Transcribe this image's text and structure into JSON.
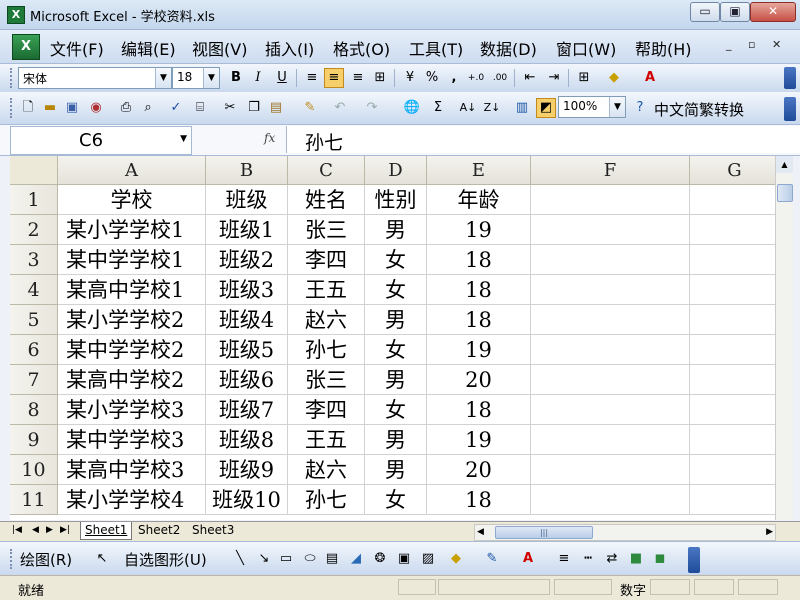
{
  "window": {
    "title": "Microsoft Excel - 学校资料.xls",
    "controls": {
      "minimize": "▭",
      "restore": "▣",
      "close": "✕"
    }
  },
  "menubar": {
    "items": [
      "文件(F)",
      "编辑(E)",
      "视图(V)",
      "插入(I)",
      "格式(O)",
      "工具(T)",
      "数据(D)",
      "窗口(W)",
      "帮助(H)"
    ],
    "doc_controls": {
      "minimize": "_",
      "restore": "▫",
      "close": "✕"
    }
  },
  "format_toolbar": {
    "font": "宋体",
    "size": "18",
    "bold": "B",
    "italic": "I",
    "underline": "U",
    "percent": "%",
    "comma": ","
  },
  "standard_toolbar": {
    "zoom": "100%",
    "chinese_convert": "中文简繁转换"
  },
  "formula_bar": {
    "name_box": "C6",
    "fx": "fx",
    "value": "孙七"
  },
  "sheet": {
    "columns": [
      "A",
      "B",
      "C",
      "D",
      "E",
      "F",
      "G"
    ],
    "row_numbers": [
      "1",
      "2",
      "3",
      "4",
      "5",
      "6",
      "7",
      "8",
      "9",
      "10",
      "11"
    ],
    "header": [
      "学校",
      "班级",
      "姓名",
      "性别",
      "年龄"
    ],
    "rows": [
      [
        "某小学学校1",
        "班级1",
        "张三",
        "男",
        "19"
      ],
      [
        "某中学学校1",
        "班级2",
        "李四",
        "女",
        "18"
      ],
      [
        "某高中学校1",
        "班级3",
        "王五",
        "女",
        "18"
      ],
      [
        "某小学学校2",
        "班级4",
        "赵六",
        "男",
        "18"
      ],
      [
        "某中学学校2",
        "班级5",
        "孙七",
        "女",
        "19"
      ],
      [
        "某高中学校2",
        "班级6",
        "张三",
        "男",
        "20"
      ],
      [
        "某小学学校3",
        "班级7",
        "李四",
        "女",
        "18"
      ],
      [
        "某中学学校3",
        "班级8",
        "王五",
        "男",
        "19"
      ],
      [
        "某高中学校3",
        "班级9",
        "赵六",
        "男",
        "20"
      ],
      [
        "某小学学校4",
        "班级10",
        "孙七",
        "女",
        "18"
      ]
    ]
  },
  "sheet_tabs": [
    "Sheet1",
    "Sheet2",
    "Sheet3"
  ],
  "draw_toolbar": {
    "draw": "绘图(R)",
    "autoshapes": "自选图形(U)"
  },
  "statusbar": {
    "ready": "就绪",
    "numlock": "数字"
  }
}
